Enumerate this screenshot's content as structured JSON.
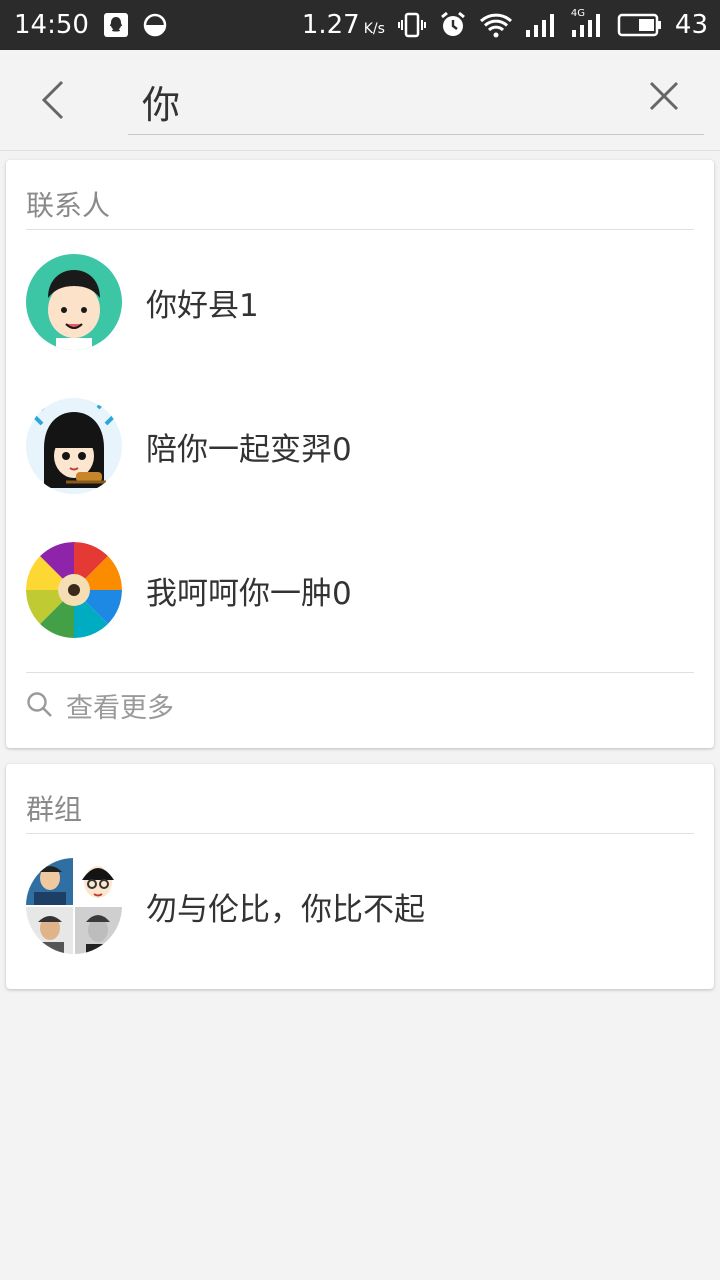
{
  "status_bar": {
    "time": "14:50",
    "speed": "1.27",
    "speed_unit": "K/s",
    "network": "4G",
    "battery": "43"
  },
  "search": {
    "query": "你"
  },
  "contacts": {
    "title": "联系人",
    "items": [
      {
        "name": "你好县1"
      },
      {
        "name": "陪你一起变羿0"
      },
      {
        "name": "我呵呵你一肿0"
      }
    ],
    "more_label": "查看更多"
  },
  "groups": {
    "title": "群组",
    "items": [
      {
        "name": "勿与伦比，你比不起"
      }
    ]
  },
  "colors": {
    "status_bar_bg": "#2b2b2b",
    "page_bg": "#f3f3f3",
    "card_bg": "#ffffff",
    "secondary_text": "#8a8a8a"
  }
}
